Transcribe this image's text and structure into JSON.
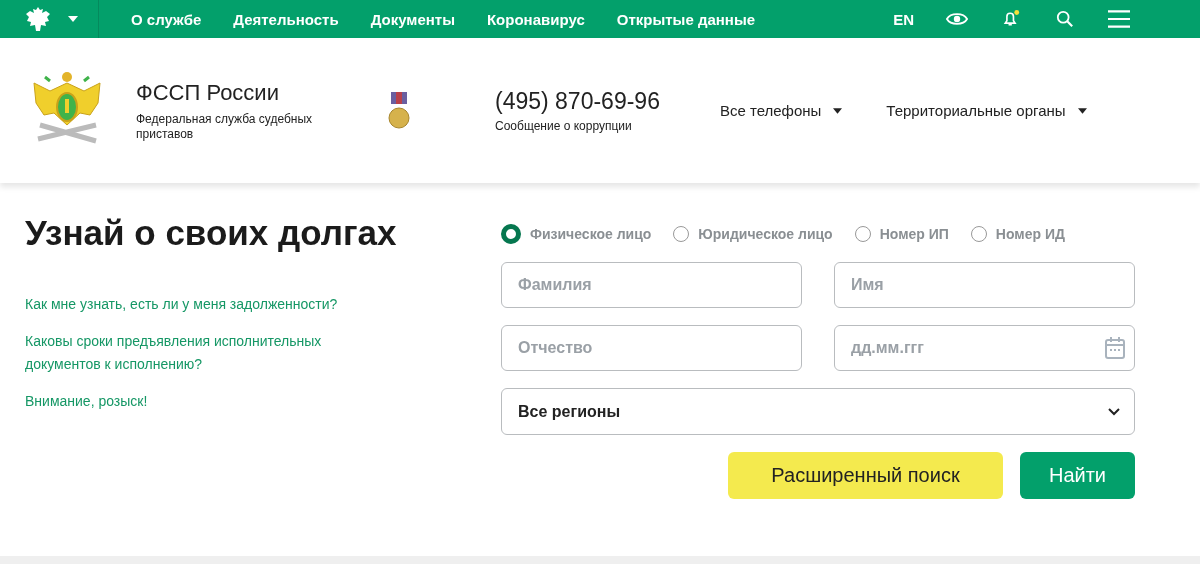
{
  "top_nav": {
    "items": [
      "О службе",
      "Деятельность",
      "Документы",
      "Коронавирус",
      "Открытые данные"
    ],
    "language": "EN"
  },
  "header": {
    "title": "ФССП России",
    "subtitle": "Федеральная служба судебных приставов",
    "phone": "(495) 870-69-96",
    "phone_note": "Сообщение о коррупции",
    "dropdowns": [
      "Все телефоны",
      "Территориальные органы"
    ]
  },
  "debts": {
    "heading": "Узнай о своих долгах",
    "links": [
      "Как мне узнать, есть ли у меня задолженности?",
      "Каковы сроки предъявления исполнительных документов к исполнению?",
      "Внимание, розыск!"
    ],
    "search_types": [
      {
        "label": "Физическое лицо",
        "selected": true
      },
      {
        "label": "Юридическое лицо",
        "selected": false
      },
      {
        "label": "Номер ИП",
        "selected": false
      },
      {
        "label": "Номер ИД",
        "selected": false
      }
    ],
    "fields": [
      {
        "kind": "text",
        "placeholder": "Фамилия"
      },
      {
        "kind": "text",
        "placeholder": "Имя"
      },
      {
        "kind": "text",
        "placeholder": "Отчество"
      },
      {
        "kind": "date",
        "placeholder": "дд.мм.ггг"
      }
    ],
    "region": "Все регионы",
    "buttons": [
      {
        "kind": "secondary",
        "label": "Расширенный поиск"
      },
      {
        "kind": "primary",
        "label": "Найти"
      }
    ]
  }
}
